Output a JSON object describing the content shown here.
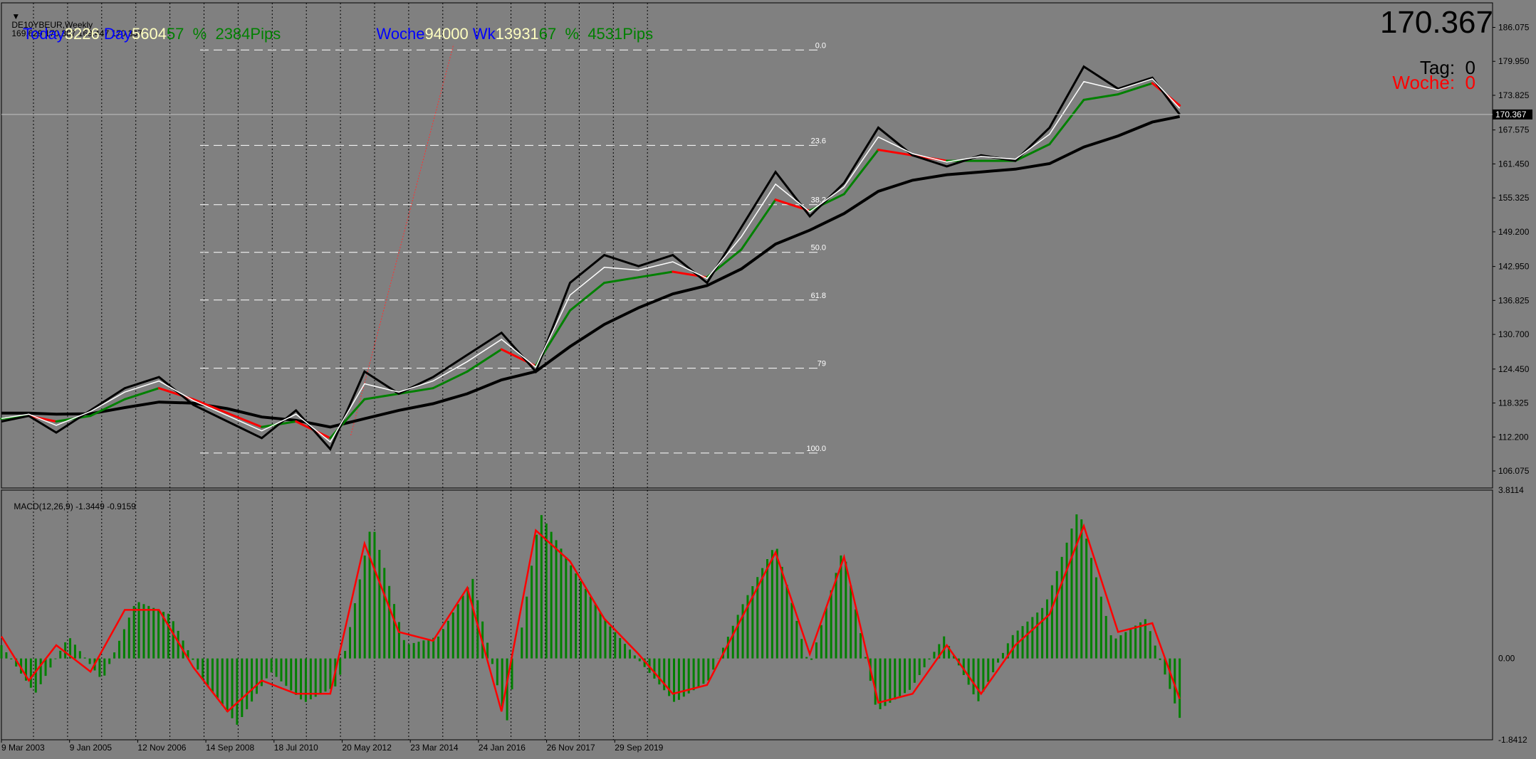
{
  "window": {
    "title": "DE10YBEUR,Weekly",
    "ohlc": "169.629 170.387 169.447 170.367"
  },
  "header_left": {
    "today_label": "Today",
    "today_value": "3226",
    "day_label": "Day",
    "day_value": "5604",
    "day_pct": "57",
    "pct_sign": "%",
    "day_pips_value": "2384",
    "pips_label": "Pips"
  },
  "header_right": {
    "woche_label": "Woche",
    "woche_value": "94000",
    "wk_label": "Wk",
    "wk_value": "13931",
    "wk_pct": "67",
    "pct_sign": "%",
    "wk_pips_value": "4531",
    "pips_label": "Pips"
  },
  "price_panel": {
    "current_price": "170.367",
    "tag_label": "Tag:",
    "tag_value": "0",
    "woche_label": "Woche:",
    "woche_value": "0"
  },
  "macd": {
    "label": "MACD(12,26,9)",
    "main_value": "-1.3449",
    "signal_value": "-0.9159"
  },
  "colors": {
    "background": "#808080",
    "price_line": "#000000",
    "ma_slow": "#000000",
    "ma_fast_up": "#008000",
    "ma_fast_down": "#ff0000",
    "white_line": "#ffffff",
    "fib_lines": "#ffffff",
    "today_blue": "#0000ff",
    "value_yellow": "#ffffc0",
    "pct_green": "#008000",
    "histogram": "#008000",
    "signal": "#ff0000"
  },
  "chart_data": [
    {
      "type": "line",
      "instrument": "DE10YBEUR",
      "timeframe": "Weekly",
      "grid": false,
      "ylim": [
        103.0,
        190.5
      ],
      "y_ticks": [
        "186.075",
        "179.950",
        "173.825",
        "167.575",
        "161.450",
        "155.325",
        "149.200",
        "142.950",
        "136.825",
        "130.700",
        "124.450",
        "118.325",
        "112.200",
        "106.075"
      ],
      "x_tick_labels": [
        "9 Mar 2003",
        "9 Jan 2005",
        "12 Nov 2006",
        "14 Sep 2008",
        "18 Jul 2010",
        "20 May 2012",
        "23 Mar 2014",
        "24 Jan 2016",
        "26 Nov 2017",
        "29 Sep 2019"
      ],
      "x": [
        2003.2,
        2003.6,
        2004.0,
        2004.5,
        2005.0,
        2005.5,
        2006.0,
        2006.5,
        2007.0,
        2007.5,
        2008.0,
        2008.5,
        2009.0,
        2009.5,
        2010.0,
        2010.5,
        2011.0,
        2011.5,
        2012.0,
        2012.5,
        2013.0,
        2013.5,
        2014.0,
        2014.5,
        2015.0,
        2015.5,
        2016.0,
        2016.5,
        2017.0,
        2017.5,
        2018.0,
        2018.5,
        2019.0,
        2019.5,
        2020.0,
        2020.4
      ],
      "series": [
        {
          "values": [
            115,
            116,
            113,
            117,
            121,
            123,
            118,
            115,
            112,
            117,
            110,
            124,
            120,
            123,
            127,
            131,
            124,
            140,
            145,
            143,
            145,
            140,
            150,
            160,
            152,
            158,
            168,
            163,
            161,
            163,
            162,
            168,
            179,
            175,
            177,
            170.367
          ]
        },
        {
          "values": [
            115.5,
            116,
            115,
            116,
            119,
            121,
            119,
            116.5,
            114,
            115,
            112,
            119,
            120,
            121,
            124,
            128,
            125,
            135,
            140,
            141,
            142,
            141,
            146,
            155,
            153,
            156,
            164,
            163,
            162,
            162,
            162,
            165,
            173,
            174,
            176,
            172
          ]
        },
        {
          "values": [
            116.5,
            116.5,
            116.3,
            116.4,
            117.5,
            118.5,
            118.3,
            117.3,
            115.8,
            115.2,
            114.0,
            115.5,
            117.0,
            118.2,
            120.0,
            122.5,
            124.0,
            128.5,
            132.5,
            135.5,
            138.0,
            139.5,
            142.5,
            147.0,
            149.5,
            152.5,
            156.5,
            158.5,
            159.5,
            160.0,
            160.5,
            161.5,
            164.5,
            166.5,
            169.0,
            170.0
          ]
        }
      ],
      "fibonacci_levels": [
        {
          "label": "0.0",
          "price": 182.0
        },
        {
          "label": "23.6",
          "price": 164.8
        },
        {
          "label": "38.2",
          "price": 154.1
        },
        {
          "label": "50.0",
          "price": 145.5
        },
        {
          "label": "61.8",
          "price": 136.9
        },
        {
          "label": "79",
          "price": 124.6
        },
        {
          "label": "100.0",
          "price": 109.3
        }
      ],
      "current_price": 170.367
    },
    {
      "type": "bar",
      "title": "MACD(12,26,9)",
      "ylim": [
        -1.8412,
        3.8114
      ],
      "y_ticks": [
        "3.8114",
        "0.00",
        "-1.8412"
      ],
      "x": [
        2003.2,
        2003.6,
        2004.0,
        2004.5,
        2005.0,
        2005.5,
        2006.0,
        2006.5,
        2007.0,
        2007.5,
        2008.0,
        2008.5,
        2009.0,
        2009.5,
        2010.0,
        2010.5,
        2011.0,
        2011.5,
        2012.0,
        2012.5,
        2013.0,
        2013.5,
        2014.0,
        2014.5,
        2015.0,
        2015.5,
        2016.0,
        2016.5,
        2017.0,
        2017.5,
        2018.0,
        2018.5,
        2019.0,
        2019.5,
        2020.0,
        2020.4
      ],
      "series": [
        {
          "values": [
            0.3,
            -0.8,
            0.5,
            -0.5,
            1.3,
            1.0,
            -0.5,
            -1.5,
            -0.3,
            -1.0,
            -0.6,
            3.1,
            0.3,
            0.5,
            1.8,
            -1.5,
            3.3,
            2.0,
            0.8,
            -0.1,
            -1.0,
            -0.5,
            1.2,
            2.6,
            -0.2,
            2.5,
            -1.2,
            -0.7,
            0.5,
            -1.0,
            0.5,
            1.2,
            3.4,
            0.4,
            0.9,
            -1.3449
          ]
        },
        {
          "values": [
            0.5,
            -0.5,
            0.3,
            -0.3,
            1.1,
            1.1,
            -0.2,
            -1.2,
            -0.5,
            -0.8,
            -0.8,
            2.6,
            0.6,
            0.4,
            1.6,
            -1.2,
            2.9,
            2.2,
            0.9,
            0.1,
            -0.8,
            -0.6,
            0.9,
            2.4,
            0.1,
            2.3,
            -1.0,
            -0.8,
            0.3,
            -0.8,
            0.3,
            1.0,
            3.0,
            0.6,
            0.8,
            -0.9159
          ]
        }
      ]
    }
  ]
}
